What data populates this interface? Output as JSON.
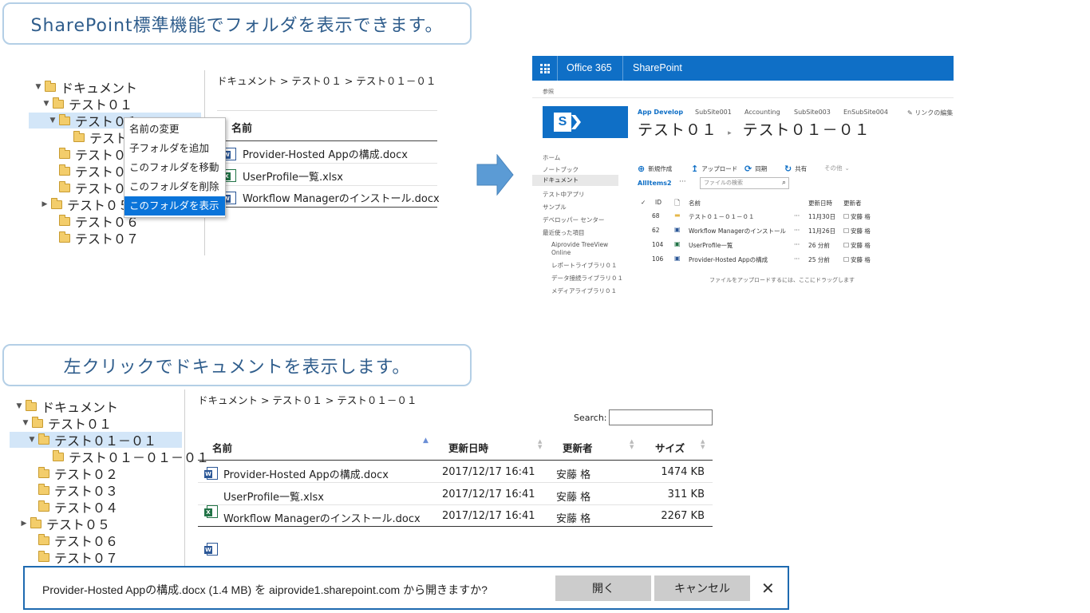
{
  "callout_top": "SharePoint標準機能でフォルダを表示できます。",
  "callout_bottom": "左クリックでドキュメントを表示します。",
  "tree_top": [
    {
      "label": "ドキュメント",
      "twisty": "▼"
    },
    {
      "label": "テスト０１",
      "twisty": "▼"
    },
    {
      "label": "テスト０１－",
      "twisty": "▼",
      "selected": true
    },
    {
      "label": "テスト０１",
      "twisty": ""
    },
    {
      "label": "テスト０２",
      "twisty": ""
    },
    {
      "label": "テスト０３",
      "twisty": ""
    },
    {
      "label": "テスト０４",
      "twisty": ""
    },
    {
      "label": "テスト０５",
      "twisty": "▶"
    },
    {
      "label": "テスト０６",
      "twisty": ""
    },
    {
      "label": "テスト０７",
      "twisty": ""
    }
  ],
  "context_menu": [
    "名前の変更",
    "子フォルダを追加",
    "このフォルダを移動",
    "このフォルダを削除",
    "このフォルダを表示"
  ],
  "top_breadcrumb": "ドキュメント > テスト０１ > テスト０１－０１",
  "top_list_header": "名前",
  "top_files": [
    "Provider-Hosted Appの構成.docx",
    "UserProfile一覧.xlsx",
    "Workflow Managerのインストール.docx"
  ],
  "sharepoint": {
    "brand1": "Office 365",
    "brand2": "SharePoint",
    "browse": "参照",
    "tabs": [
      "App Develop",
      "SubSite001",
      "Accounting",
      "SubSite003",
      "EnSubSite004"
    ],
    "edit_links": "リンクの編集",
    "title_left": "テスト０１",
    "title_right": "テスト０１－０１",
    "nav": [
      "ホーム",
      "ノートブック",
      "ドキュメント",
      "テスト中アプリ",
      "サンプル",
      "デベロッパー センター",
      "最近使った項目",
      "Aiprovide TreeView",
      "Online",
      "レポートライブラリ０１",
      "データ接続ライブラリ０１",
      "メディアライブラリ０１"
    ],
    "commands": [
      "新規作成",
      "アップロード",
      "同期",
      "共有",
      "その他"
    ],
    "view": "AllItems2",
    "search_placeholder": "ファイルの検索",
    "columns": [
      "ID",
      "名前",
      "更新日時",
      "更新者"
    ],
    "rows": [
      {
        "id": "68",
        "name": "テスト０１－０１－０１",
        "date": "11月30日",
        "author": "安藤 格"
      },
      {
        "id": "62",
        "name": "Workflow Managerのインストール",
        "date": "11月26日",
        "author": "安藤 格"
      },
      {
        "id": "104",
        "name": "UserProfile一覧",
        "date": "26 分前",
        "author": "安藤 格"
      },
      {
        "id": "106",
        "name": "Provider-Hosted Appの構成",
        "date": "25 分前",
        "author": "安藤 格"
      }
    ],
    "hint": "ファイルをアップロードするには、ここにドラッグします"
  },
  "tree_bottom": [
    {
      "label": "ドキュメント",
      "twisty": "▼"
    },
    {
      "label": "テスト０１",
      "twisty": "▼"
    },
    {
      "label": "テスト０１－０１",
      "twisty": "▼",
      "selected": true
    },
    {
      "label": "テスト０１－０１－０１",
      "twisty": ""
    },
    {
      "label": "テスト０２",
      "twisty": ""
    },
    {
      "label": "テスト０３",
      "twisty": ""
    },
    {
      "label": "テスト０４",
      "twisty": ""
    },
    {
      "label": "テスト０５",
      "twisty": "▶"
    },
    {
      "label": "テスト０６",
      "twisty": ""
    },
    {
      "label": "テスト０７",
      "twisty": ""
    }
  ],
  "bottom_breadcrumb": "ドキュメント > テスト０１ > テスト０１－０１",
  "search_label": "Search:",
  "table": {
    "headers": [
      "名前",
      "更新日時",
      "更新者",
      "サイズ"
    ],
    "rows": [
      {
        "name": "Provider-Hosted Appの構成.docx",
        "type": "docx",
        "date": "2017/12/17 16:41",
        "author": "安藤 格",
        "size": "1474 KB"
      },
      {
        "name": "UserProfile一覧.xlsx",
        "type": "xlsx",
        "date": "2017/12/17 16:41",
        "author": "安藤 格",
        "size": "311 KB"
      },
      {
        "name": "Workflow Managerのインストール.docx",
        "type": "docx",
        "date": "2017/12/17 16:41",
        "author": "安藤 格",
        "size": "2267 KB"
      }
    ]
  },
  "download_bar": {
    "message": "Provider-Hosted Appの構成.docx (1.4 MB) を aiprovide1.sharepoint.com から開きますか?",
    "open": "開く",
    "cancel": "キャンセル",
    "close": "✕"
  }
}
